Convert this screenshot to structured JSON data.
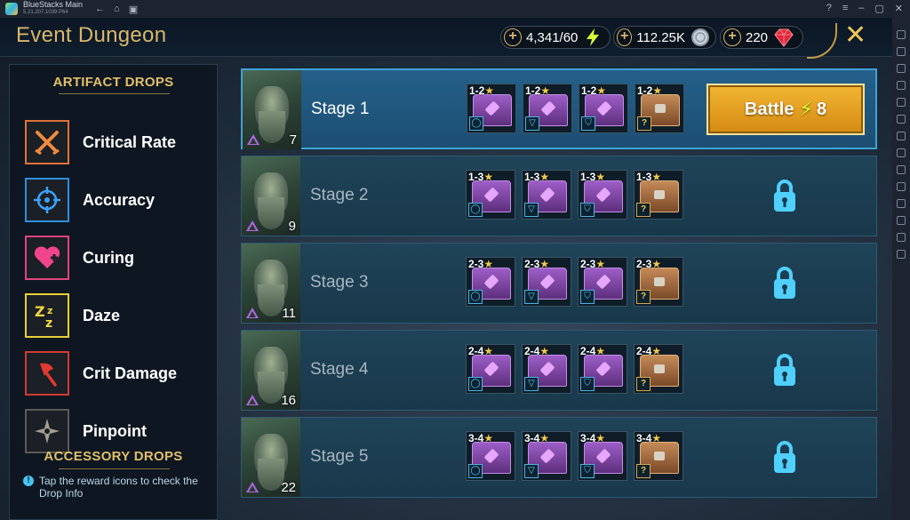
{
  "window": {
    "app_name": "BlueStacks Main",
    "version": "5.21.207.1039 P64"
  },
  "header": {
    "title": "Event Dungeon",
    "energy": "4,341/60",
    "silver": "112.25K",
    "gems": "220"
  },
  "left_panel": {
    "artifact_title": "ARTIFACT DROPS",
    "accessory_title": "ACCESSORY DROPS",
    "sets": [
      {
        "label": "Critical Rate",
        "icon": "crossed-swords-icon",
        "color": "#e0733a"
      },
      {
        "label": "Accuracy",
        "icon": "crosshair-icon",
        "color": "#2f8ee0"
      },
      {
        "label": "Curing",
        "icon": "heart-plus-icon",
        "color": "#e0447e"
      },
      {
        "label": "Daze",
        "icon": "zzz-icon",
        "color": "#e8cf3a"
      },
      {
        "label": "Crit Damage",
        "icon": "axe-icon",
        "color": "#d33a2f"
      },
      {
        "label": "Pinpoint",
        "icon": "compass-star-icon",
        "color": "#8e8a7c"
      }
    ],
    "hint": "Tap the reward icons to check the Drop Info"
  },
  "stages": [
    {
      "name": "Stage 1",
      "level": "7",
      "tier": "1-2",
      "status": "unlocked",
      "battle_label": "Battle",
      "battle_cost": "8"
    },
    {
      "name": "Stage 2",
      "level": "9",
      "tier": "1-3",
      "status": "locked"
    },
    {
      "name": "Stage 3",
      "level": "11",
      "tier": "2-3",
      "status": "locked"
    },
    {
      "name": "Stage 4",
      "level": "16",
      "tier": "2-4",
      "status": "locked"
    },
    {
      "name": "Stage 5",
      "level": "22",
      "tier": "3-4",
      "status": "locked"
    }
  ],
  "colors": {
    "accent_gold": "#d9b76b",
    "battle_button": "#e9a323",
    "lock": "#4fd0ff"
  }
}
